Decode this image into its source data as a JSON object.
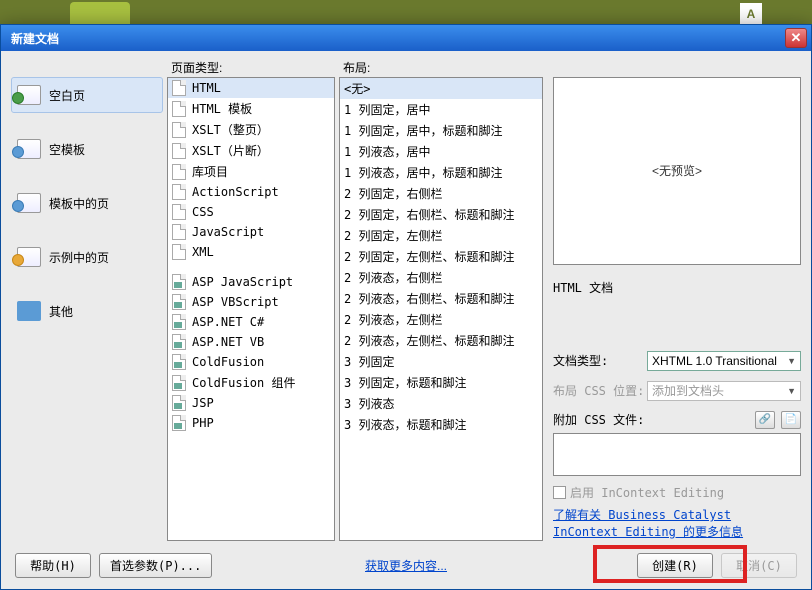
{
  "dialog": {
    "title": "新建文档"
  },
  "sidebar": {
    "items": [
      {
        "label": "空白页",
        "selected": true
      },
      {
        "label": "空模板"
      },
      {
        "label": "模板中的页"
      },
      {
        "label": "示例中的页"
      },
      {
        "label": "其他"
      }
    ]
  },
  "pageTypes": {
    "header": "页面类型:",
    "groupA": [
      "HTML",
      "HTML 模板",
      "XSLT（整页）",
      "XSLT（片断）",
      "库项目",
      "ActionScript",
      "CSS",
      "JavaScript",
      "XML"
    ],
    "groupB": [
      "ASP JavaScript",
      "ASP VBScript",
      "ASP.NET C#",
      "ASP.NET VB",
      "ColdFusion",
      "ColdFusion 组件",
      "JSP",
      "PHP"
    ],
    "selected": "HTML"
  },
  "layouts": {
    "header": "布局:",
    "items": [
      "<无>",
      "1 列固定，居中",
      "1 列固定，居中，标题和脚注",
      "1 列液态，居中",
      "1 列液态，居中，标题和脚注",
      "2 列固定，右侧栏",
      "2 列固定，右侧栏、标题和脚注",
      "2 列固定，左侧栏",
      "2 列固定，左侧栏、标题和脚注",
      "2 列液态，右侧栏",
      "2 列液态，右侧栏、标题和脚注",
      "2 列液态，左侧栏",
      "2 列液态，左侧栏、标题和脚注",
      "3 列固定",
      "3 列固定，标题和脚注",
      "3 列液态",
      "3 列液态，标题和脚注"
    ],
    "selected": "<无>"
  },
  "right": {
    "preview": "<无预览>",
    "docType": "HTML 文档",
    "docTypeLabel": "文档类型:",
    "docTypeValue": "XHTML 1.0 Transitional",
    "layoutCssLabel": "布局 CSS 位置:",
    "layoutCssValue": "添加到文档头",
    "attachLabel": "附加 CSS 文件:",
    "enableInContext": "启用 InContext Editing",
    "learnLink": "了解有关 Business Catalyst InContext Editing 的更多信息"
  },
  "footer": {
    "help": "帮助(H)",
    "prefs": "首选参数(P)...",
    "getMore": "获取更多内容...",
    "create": "创建(R)",
    "cancel": "取消(C)"
  }
}
